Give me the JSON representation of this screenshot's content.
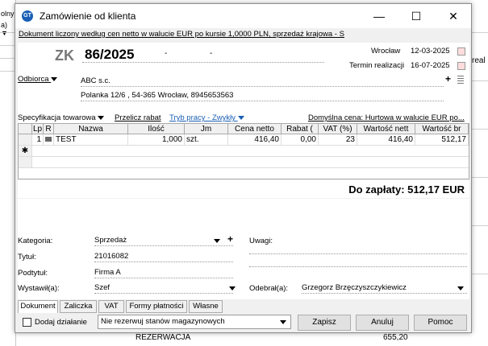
{
  "background": {
    "left_texts": [
      "olny",
      "a) ▼"
    ],
    "right_text": "real",
    "bottom_texts": [
      "REZERWACJA",
      "655,20"
    ]
  },
  "window": {
    "title": "Zamówienie od klienta",
    "minimize": "—",
    "maximize": "☐",
    "close": "✕"
  },
  "info_line": "Dokument liczony według cen netto w walucie EUR po kursie 1,0000 PLN, sprzedaż krajowa - S",
  "doc": {
    "prefix": "ZK",
    "number": "86/2025",
    "dash1": "-",
    "dash2": "-",
    "place": "Wrocław",
    "issue_date": "12-03-2025",
    "deadline_label": "Termin realizacji",
    "deadline_date": "16-07-2025"
  },
  "client": {
    "label": "Odbiorca",
    "name": "ABC s.c.",
    "address": "Polanka  12/6 , 54-365 Wrocław, 8945653563",
    "plus": "+"
  },
  "toolbar": {
    "spec": "Specyfikacja towarowa",
    "recalc": "Przelicz rabat",
    "mode": "Tryb pracy - Zwykły",
    "default_price": "Domyślna cena: Hurtowa w walucie EUR po..."
  },
  "table": {
    "headers": [
      "Lp",
      "R",
      "Nazwa",
      "Ilość",
      "Jm",
      "Cena netto",
      "Rabat (",
      "VAT (%)",
      "Wartość nett",
      "Wartość br"
    ],
    "rows": [
      {
        "lp": "1",
        "name": "TEST",
        "qty": "1,000",
        "unit": "szt.",
        "net_price": "416,40",
        "discount": "0,00",
        "vat": "23",
        "net_value": "416,40",
        "gross_value": "512,17"
      }
    ],
    "new_row_marker": "✱"
  },
  "total": "Do zapłaty: 512,17 EUR",
  "fields": {
    "category_label": "Kategoria:",
    "category_value": "Sprzedaż",
    "title_label": "Tytuł:",
    "title_value": "21016082",
    "subtitle_label": "Podtytuł:",
    "subtitle_value": "Firma A",
    "issued_label": "Wystawił(a):",
    "issued_value": "Szef",
    "notes_label": "Uwagi:",
    "received_label": "Odebrał(a):",
    "received_value": "Grzegorz Brzęczyszczykiewicz",
    "plus": "+"
  },
  "tabs": [
    "Dokument",
    "Zaliczka",
    "VAT",
    "Formy płatności",
    "Własne"
  ],
  "bottom": {
    "add_action": "Dodaj działanie",
    "reserve_select": "Nie rezerwuj stanów magazynowych",
    "save": "Zapisz",
    "cancel": "Anuluj",
    "help": "Pomoc"
  }
}
